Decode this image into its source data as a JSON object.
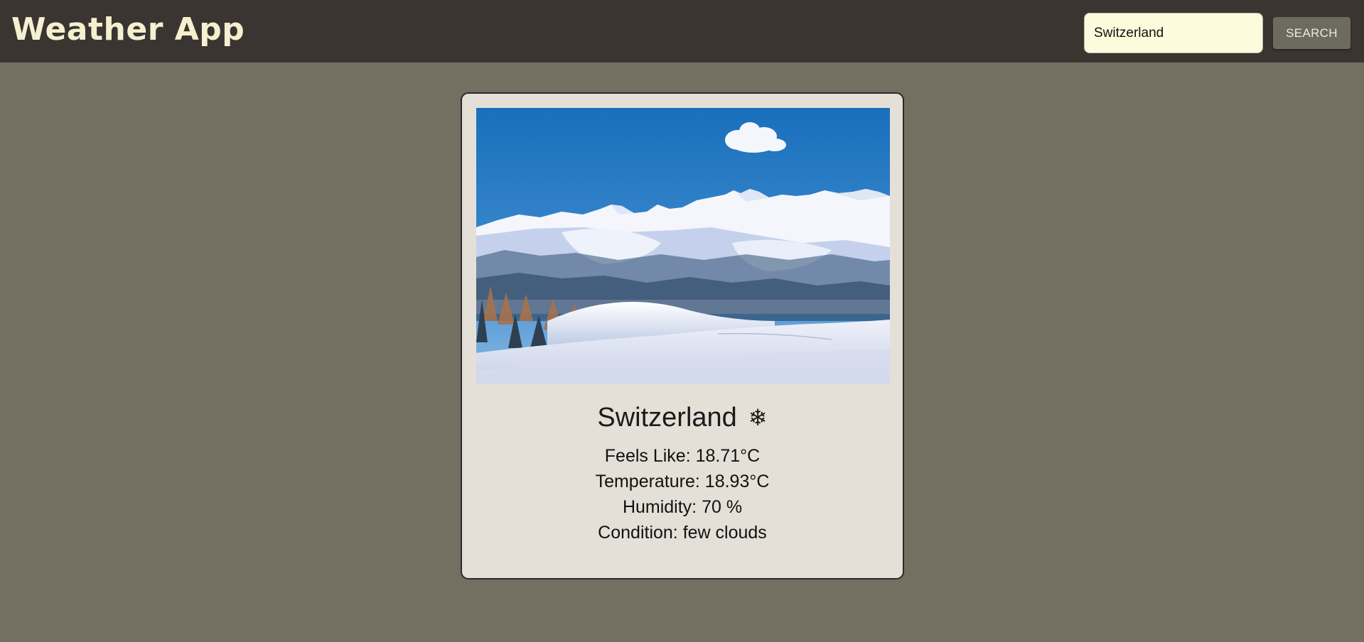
{
  "header": {
    "title": "Weather App"
  },
  "search": {
    "value": "Switzerland",
    "button_label": "SEARCH"
  },
  "weather": {
    "city": "Switzerland",
    "icon": "snowflake-icon",
    "icon_glyph": "❄",
    "feels_like": "Feels Like: 18.71°C",
    "temperature": "Temperature: 18.93°C",
    "humidity": "Humidity: 70 %",
    "condition": "Condition: few clouds"
  },
  "image": {
    "subject": "snowy mountain landscape"
  },
  "colors": {
    "header_bg": "#3a3531",
    "page_bg": "#737062",
    "card_bg": "#e4e0d7",
    "title": "#f6efd0",
    "input_bg": "#fdfbdc",
    "button_bg": "#6d6a5e"
  }
}
